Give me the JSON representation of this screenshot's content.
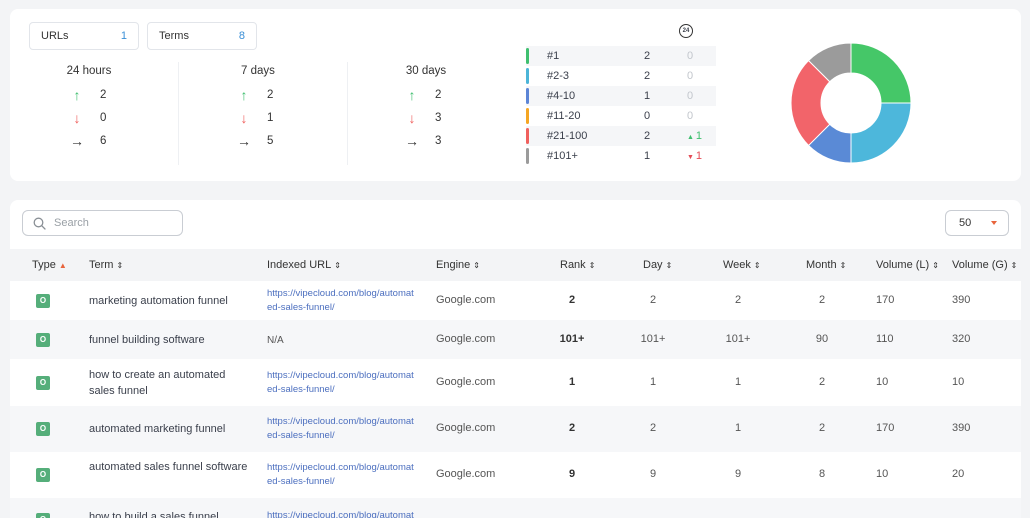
{
  "summary": {
    "urls_label": "URLs",
    "urls_count": "1",
    "terms_label": "Terms",
    "terms_count": "8",
    "periods": [
      {
        "title": "24 hours",
        "up": "2",
        "down": "0",
        "flat": "6"
      },
      {
        "title": "7 days",
        "up": "2",
        "down": "1",
        "flat": "5"
      },
      {
        "title": "30 days",
        "up": "2",
        "down": "3",
        "flat": "3"
      }
    ],
    "refresh_badge": "24"
  },
  "rank_buckets": [
    {
      "label": "#1",
      "count": "2",
      "change": "0",
      "dir": "none",
      "color": "#3fbf6f"
    },
    {
      "label": "#2-3",
      "count": "2",
      "change": "0",
      "dir": "none",
      "color": "#4cb5d8"
    },
    {
      "label": "#4-10",
      "count": "1",
      "change": "0",
      "dir": "none",
      "color": "#5c85d6"
    },
    {
      "label": "#11-20",
      "count": "0",
      "change": "0",
      "dir": "none",
      "color": "#f5a623"
    },
    {
      "label": "#21-100",
      "count": "2",
      "change": "1",
      "dir": "up",
      "color": "#f0605d"
    },
    {
      "label": "#101+",
      "count": "1",
      "change": "1",
      "dir": "down",
      "color": "#9b9b9b"
    }
  ],
  "donut": [
    {
      "value": 2,
      "color": "#45c768"
    },
    {
      "value": 2,
      "color": "#4db7db"
    },
    {
      "value": 1,
      "color": "#5a8ad6"
    },
    {
      "value": 2,
      "color": "#f2646a"
    },
    {
      "value": 1,
      "color": "#9b9b9b"
    }
  ],
  "toolbar": {
    "search_placeholder": "Search",
    "per_page": "50"
  },
  "table": {
    "headers": [
      "Type",
      "Term",
      "Indexed URL",
      "Engine",
      "Rank",
      "Day",
      "Week",
      "Month",
      "Volume (L)",
      "Volume (G)"
    ],
    "rows": [
      {
        "type": "O",
        "term": "marketing automation funnel",
        "url": "https://vipecloud.com/blog/automated-sales-funnel/",
        "engine": "Google.com",
        "rank": "2",
        "day": "2",
        "week": "2",
        "month": "2",
        "vol_l": "170",
        "vol_g": "390"
      },
      {
        "type": "O",
        "term": "funnel building software",
        "url": "N/A",
        "engine": "Google.com",
        "rank": "101+",
        "day": "101+",
        "week": "101+",
        "month": "90",
        "vol_l": "110",
        "vol_g": "320"
      },
      {
        "type": "O",
        "term": "how to create an automated sales funnel",
        "url": "https://vipecloud.com/blog/automated-sales-funnel/",
        "engine": "Google.com",
        "rank": "1",
        "day": "1",
        "week": "1",
        "month": "2",
        "vol_l": "10",
        "vol_g": "10"
      },
      {
        "type": "O",
        "term": "automated marketing funnel",
        "url": "https://vipecloud.com/blog/automated-sales-funnel/",
        "engine": "Google.com",
        "rank": "2",
        "day": "2",
        "week": "1",
        "month": "2",
        "vol_l": "170",
        "vol_g": "390"
      },
      {
        "type": "O",
        "term": "automated sales funnel software",
        "url": "https://vipecloud.com/blog/automated-sales-funnel/",
        "engine": "Google.com",
        "rank": "9",
        "day": "9",
        "week": "9",
        "month": "8",
        "vol_l": "10",
        "vol_g": "20"
      },
      {
        "type": "O",
        "term": "how to build a sales funnel",
        "url": "https://vipecloud.com/blog/automated-sales-funnel/",
        "engine": "",
        "rank": "",
        "day": "",
        "week": "",
        "month": "",
        "vol_l": "",
        "vol_g": ""
      }
    ]
  }
}
